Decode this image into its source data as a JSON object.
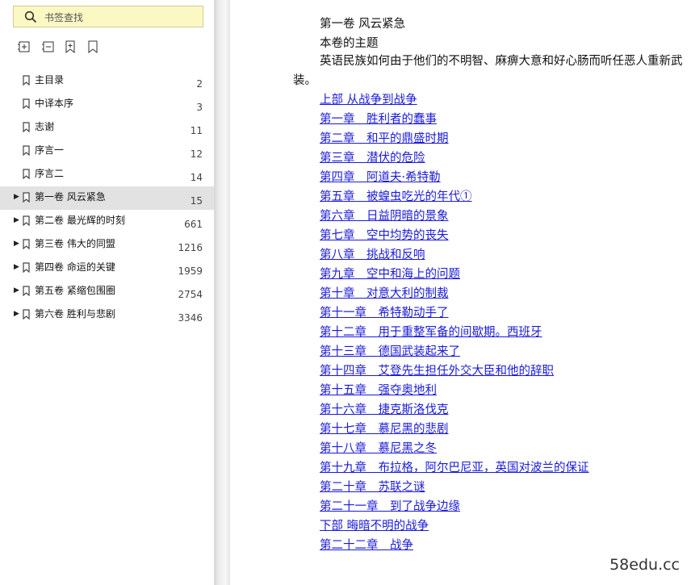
{
  "search": {
    "placeholder": "书签查找"
  },
  "toolbar": {
    "icons": [
      "expand-all-icon",
      "collapse-all-icon",
      "add-bookmark-icon",
      "bookmark-icon"
    ]
  },
  "bookmarks": [
    {
      "label": "主目录",
      "page": "2",
      "expandable": false
    },
    {
      "label": "中译本序",
      "page": "3",
      "expandable": false
    },
    {
      "label": "志谢",
      "page": "11",
      "expandable": false
    },
    {
      "label": "序言一",
      "page": "12",
      "expandable": false
    },
    {
      "label": "序言二",
      "page": "14",
      "expandable": false
    },
    {
      "label": "第一卷  风云紧急",
      "page": "15",
      "expandable": true,
      "selected": true
    },
    {
      "label": "第二卷  最光辉的时刻",
      "page": "661",
      "expandable": true
    },
    {
      "label": "第三卷  伟大的同盟",
      "page": "1216",
      "expandable": true
    },
    {
      "label": "第四卷  命运的关键",
      "page": "1959",
      "expandable": true
    },
    {
      "label": "第五卷  紧缩包围圈",
      "page": "2754",
      "expandable": true
    },
    {
      "label": "第六卷  胜利与悲剧",
      "page": "3346",
      "expandable": true
    }
  ],
  "document": {
    "volume_title": "第一卷 风云紧急",
    "theme_heading": "本卷的主题",
    "theme_text": "英语民族如何由于他们的不明智、麻痹大意和好心肠而听任恶人重新武装。",
    "links": [
      "上部 从战争到战争",
      "第一章　胜利者的蠢事",
      "第二章　和平的鼎盛时期",
      "第三章　潜伏的危险",
      "第四章　阿道夫·希特勒",
      "第五章　被蝗虫吃光的年代①",
      "第六章　日益阴暗的景象",
      "第七章　空中均势的丧失",
      "第八章　挑战和反响",
      "第九章　空中和海上的问题",
      "第十章　对意大利的制裁",
      "第十一章　希特勒动手了",
      "第十二章　用于重整军备的间歇期。西班牙",
      "第十三章　德国武装起来了",
      "第十四章　艾登先生担任外交大臣和他的辞职",
      "第十五章　强夺奥地利",
      "第十六章　捷克斯洛伐克",
      "第十七章　慕尼黑的悲剧",
      "第十八章　慕尼黑之冬",
      "第十九章　布拉格，阿尔巴尼亚，英国对波兰的保证",
      "第二十章　苏联之谜",
      "第二十一章　到了战争边缘",
      "下部 晦暗不明的战争",
      "第二十二章　战争"
    ]
  },
  "watermark": "58edu.cc",
  "colors": {
    "search_bg": "#fbf8c4",
    "link": "#1a1adb",
    "selected_row": "#e2e2e2"
  }
}
